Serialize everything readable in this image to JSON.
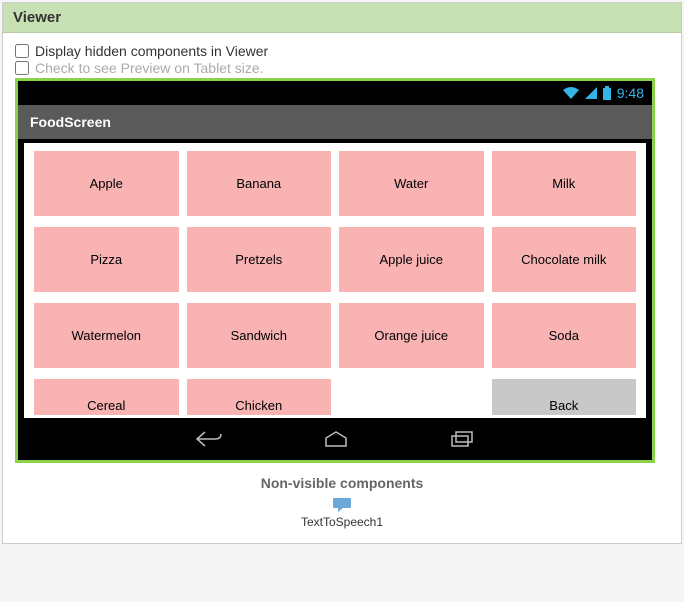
{
  "panel": {
    "title": "Viewer"
  },
  "options": {
    "display_hidden_label": "Display hidden components in Viewer",
    "tablet_preview_label": "Check to see Preview on Tablet size."
  },
  "statusbar": {
    "time": "9:48"
  },
  "appbar": {
    "title": "FoodScreen"
  },
  "grid": {
    "rows": [
      [
        "Apple",
        "Banana",
        "Water",
        "Milk"
      ],
      [
        "Pizza",
        "Pretzels",
        "Apple juice",
        "Chocolate milk"
      ],
      [
        "Watermelon",
        "Sandwich",
        "Orange juice",
        "Soda"
      ]
    ],
    "last_row": {
      "cereal": "Cereal",
      "chicken": "Chicken",
      "back": "Back"
    }
  },
  "nonvisible": {
    "title": "Non-visible components",
    "items": [
      "TextToSpeech1"
    ]
  }
}
